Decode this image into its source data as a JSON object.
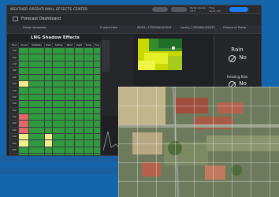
{
  "app": {
    "title": "WEATHER OPERATIONAL EFFECTS CENTER"
  },
  "header": {
    "page_title": "Forecast Dashboard"
  },
  "top_weather": {
    "line1": "Partly Cloudy",
    "line2": "74°F",
    "line3": "Time",
    "line4": "14:31 UTC"
  },
  "filters": {
    "location": "Camp Lemonnier",
    "current_hour": "Current Hour",
    "date1": "06/16 | 170000AUG2023",
    "date2": "Local || 170000AUG2023",
    "precip": "Chance of Precip"
  },
  "table": {
    "title": "LNG Shadow Effects",
    "headers": [
      "Time",
      "Cloud",
      "Visibility",
      "Rain",
      "Ceiling",
      "Wind",
      "Light",
      "Temp",
      "Fog"
    ],
    "rows": [
      [
        "15Z",
        "",
        "",
        "",
        "",
        "",
        "",
        "",
        ""
      ],
      [
        "16Z",
        "",
        "",
        "",
        "",
        "",
        "",
        "",
        ""
      ],
      [
        "17Z",
        "",
        "",
        "",
        "",
        "",
        "",
        "",
        ""
      ],
      [
        "18Z",
        "",
        "",
        "",
        "",
        "",
        "",
        "",
        ""
      ],
      [
        "19Z",
        "",
        "",
        "",
        "",
        "",
        "",
        "",
        ""
      ],
      [
        "20Z",
        "",
        "",
        "",
        "",
        "",
        "",
        "",
        ""
      ],
      [
        "21Z",
        "",
        "",
        "",
        "",
        "",
        "",
        "",
        ""
      ],
      [
        "22Z",
        "",
        "",
        "",
        "",
        "",
        "",
        "",
        ""
      ],
      [
        "23Z",
        "",
        "",
        "",
        "",
        "",
        "",
        "",
        ""
      ],
      [
        "00Z",
        "",
        "",
        "",
        "",
        "",
        "",
        "",
        ""
      ],
      [
        "01Z",
        "",
        "",
        "",
        "",
        "",
        "",
        "",
        ""
      ],
      [
        "02Z",
        "",
        "",
        "",
        "",
        "",
        "",
        "",
        ""
      ],
      [
        "03Z",
        "",
        "",
        "",
        "",
        "",
        "",
        "",
        ""
      ],
      [
        "04Z",
        "",
        "",
        "",
        "",
        "",
        "",
        "",
        ""
      ],
      [
        "05Z",
        "",
        "",
        "",
        "",
        "",
        "",
        "",
        ""
      ],
      [
        "06Z",
        "",
        "",
        "",
        "",
        "",
        "",
        "",
        ""
      ],
      [
        "07Z",
        "",
        "",
        "",
        "",
        "",
        "",
        "",
        ""
      ],
      [
        "08Z",
        "",
        "",
        "",
        "",
        "",
        "",
        "",
        ""
      ]
    ],
    "colors": [
      [
        "d",
        "g",
        "g",
        "g",
        "g",
        "g",
        "g",
        "g",
        "g"
      ],
      [
        "d",
        "g",
        "g",
        "g",
        "g",
        "g",
        "g",
        "g",
        "g"
      ],
      [
        "d",
        "g",
        "g",
        "g",
        "g",
        "g",
        "g",
        "g",
        "g"
      ],
      [
        "d",
        "g",
        "g",
        "g",
        "g",
        "g",
        "g",
        "g",
        "g"
      ],
      [
        "d",
        "g",
        "g",
        "g",
        "g",
        "g",
        "g",
        "g",
        "g"
      ],
      [
        "d",
        "y",
        "g",
        "g",
        "g",
        "g",
        "g",
        "g",
        "g"
      ],
      [
        "d",
        "g",
        "g",
        "g",
        "g",
        "g",
        "g",
        "g",
        "g"
      ],
      [
        "d",
        "g",
        "g",
        "g",
        "g",
        "g",
        "g",
        "g",
        "g"
      ],
      [
        "d",
        "g",
        "g",
        "g",
        "g",
        "g",
        "g",
        "g",
        "g"
      ],
      [
        "d",
        "g",
        "g",
        "g",
        "g",
        "g",
        "g",
        "g",
        "g"
      ],
      [
        "d",
        "r",
        "g",
        "g",
        "g",
        "g",
        "g",
        "g",
        "g"
      ],
      [
        "d",
        "r",
        "g",
        "g",
        "g",
        "g",
        "g",
        "g",
        "g"
      ],
      [
        "d",
        "r",
        "g",
        "g",
        "g",
        "g",
        "g",
        "g",
        "g"
      ],
      [
        "d",
        "y",
        "g",
        "y",
        "g",
        "g",
        "g",
        "g",
        "g"
      ],
      [
        "d",
        "y",
        "g",
        "y",
        "g",
        "g",
        "g",
        "g",
        "g"
      ],
      [
        "d",
        "g",
        "g",
        "g",
        "g",
        "g",
        "g",
        "g",
        "g"
      ],
      [
        "d",
        "g",
        "g",
        "g",
        "g",
        "g",
        "g",
        "g",
        "g"
      ],
      [
        "d",
        "g",
        "g",
        "g",
        "g",
        "g",
        "g",
        "g",
        "g"
      ]
    ]
  },
  "side_panel": {
    "rain_label": "Rain",
    "rain_value": "No",
    "freezing_label": "Freezing Rain",
    "freezing_value": "No"
  },
  "colors": {
    "green": "#2f9a3e",
    "red": "#e06a6a",
    "yellow": "#f2ef8a",
    "accent": "#1d7ef2",
    "bg": "#1565ad"
  }
}
